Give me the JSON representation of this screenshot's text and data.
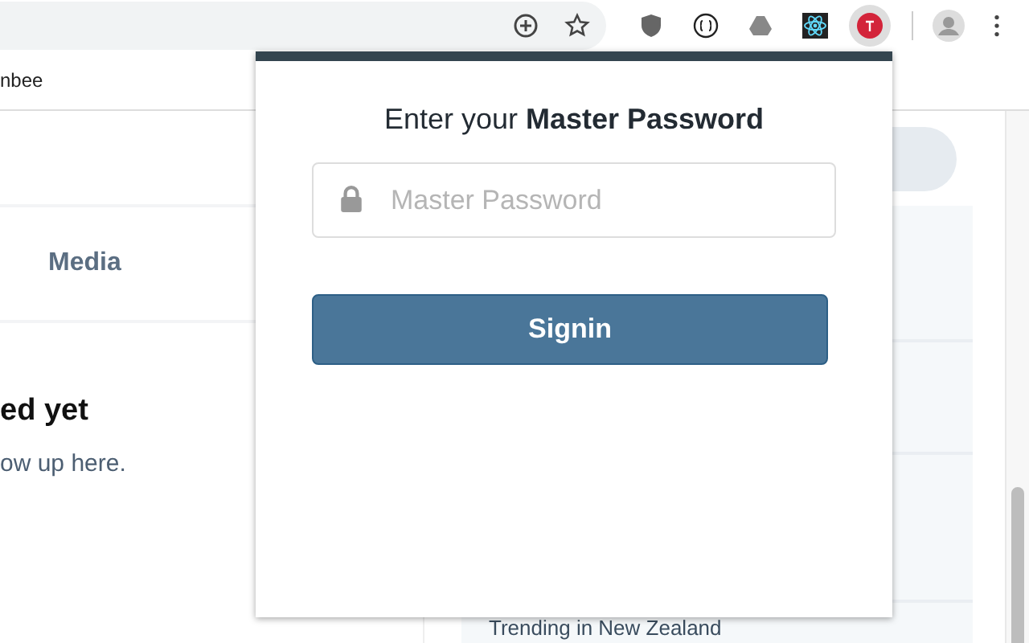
{
  "bookmarks_bar": {
    "items": [
      "nbee"
    ]
  },
  "timeline": {
    "tab": "Media",
    "empty_title": "ed yet",
    "empty_text": "ow up here."
  },
  "sidebar": {
    "trend_heading": "Trending in New Zealand"
  },
  "popup": {
    "title": "Enter your **Master Password**",
    "password_field": {
      "placeholder": "Master Password"
    },
    "button": "Signin"
  }
}
